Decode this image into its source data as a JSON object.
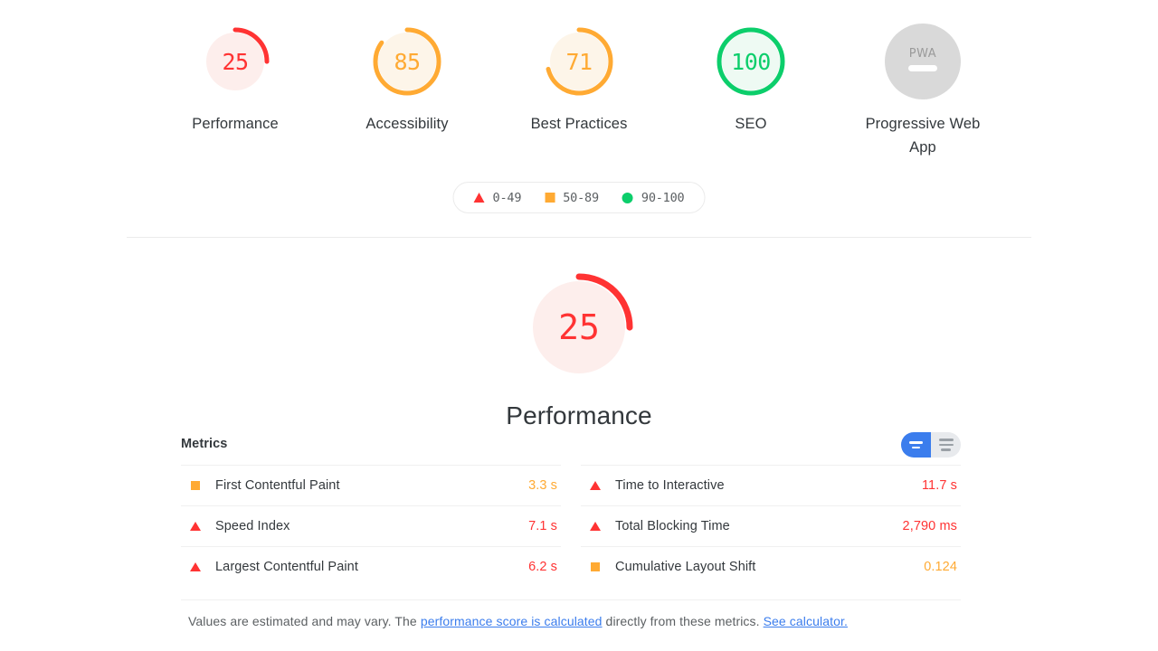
{
  "scores": [
    {
      "label": "Performance",
      "value": "25",
      "number": 25,
      "rating": "fail",
      "color": "#f33",
      "track": "#fdeeec"
    },
    {
      "label": "Accessibility",
      "value": "85",
      "number": 85,
      "rating": "average",
      "color": "#fa3",
      "track": "#fdf5e9"
    },
    {
      "label": "Best Practices",
      "value": "71",
      "number": 71,
      "rating": "average",
      "color": "#fa3",
      "track": "#fdf5e9"
    },
    {
      "label": "SEO",
      "value": "100",
      "number": 100,
      "rating": "pass",
      "color": "#0cce6b",
      "track": "#eefaf3"
    }
  ],
  "pwa": {
    "badge_text": "PWA",
    "label": "Progressive Web App",
    "circle_color": "#d9d9d9",
    "dash_color": "#ffffff"
  },
  "legend": {
    "items": [
      {
        "shape": "triangle",
        "range": "0-49",
        "color": "#f33"
      },
      {
        "shape": "square",
        "range": "50-89",
        "color": "#fa3"
      },
      {
        "shape": "circle",
        "range": "90-100",
        "color": "#0cce6b"
      }
    ]
  },
  "category": {
    "title": "Performance",
    "score": "25",
    "score_number": 25,
    "color": "#f33",
    "track": "#fdeeec"
  },
  "metrics_section": {
    "title": "Metrics",
    "toggle": {
      "active_view": "simple",
      "active_color": "#3b7ded",
      "inactive_color": "#e8eaed"
    },
    "left_column": [
      {
        "icon": "square",
        "name": "First Contentful Paint",
        "value": "3.3 s",
        "rating": "average"
      },
      {
        "icon": "triangle",
        "name": "Speed Index",
        "value": "7.1 s",
        "rating": "fail"
      },
      {
        "icon": "triangle",
        "name": "Largest Contentful Paint",
        "value": "6.2 s",
        "rating": "fail"
      }
    ],
    "right_column": [
      {
        "icon": "triangle",
        "name": "Time to Interactive",
        "value": "11.7 s",
        "rating": "fail"
      },
      {
        "icon": "triangle",
        "name": "Total Blocking Time",
        "value": "2,790 ms",
        "rating": "fail"
      },
      {
        "icon": "square",
        "name": "Cumulative Layout Shift",
        "value": "0.124",
        "rating": "average"
      }
    ],
    "footnote": {
      "text_before": "Values are estimated and may vary. The ",
      "link1": "performance score is calculated",
      "text_middle": " directly from these metrics. ",
      "link2": "See calculator.",
      "link_color": "#3b7ded"
    }
  }
}
